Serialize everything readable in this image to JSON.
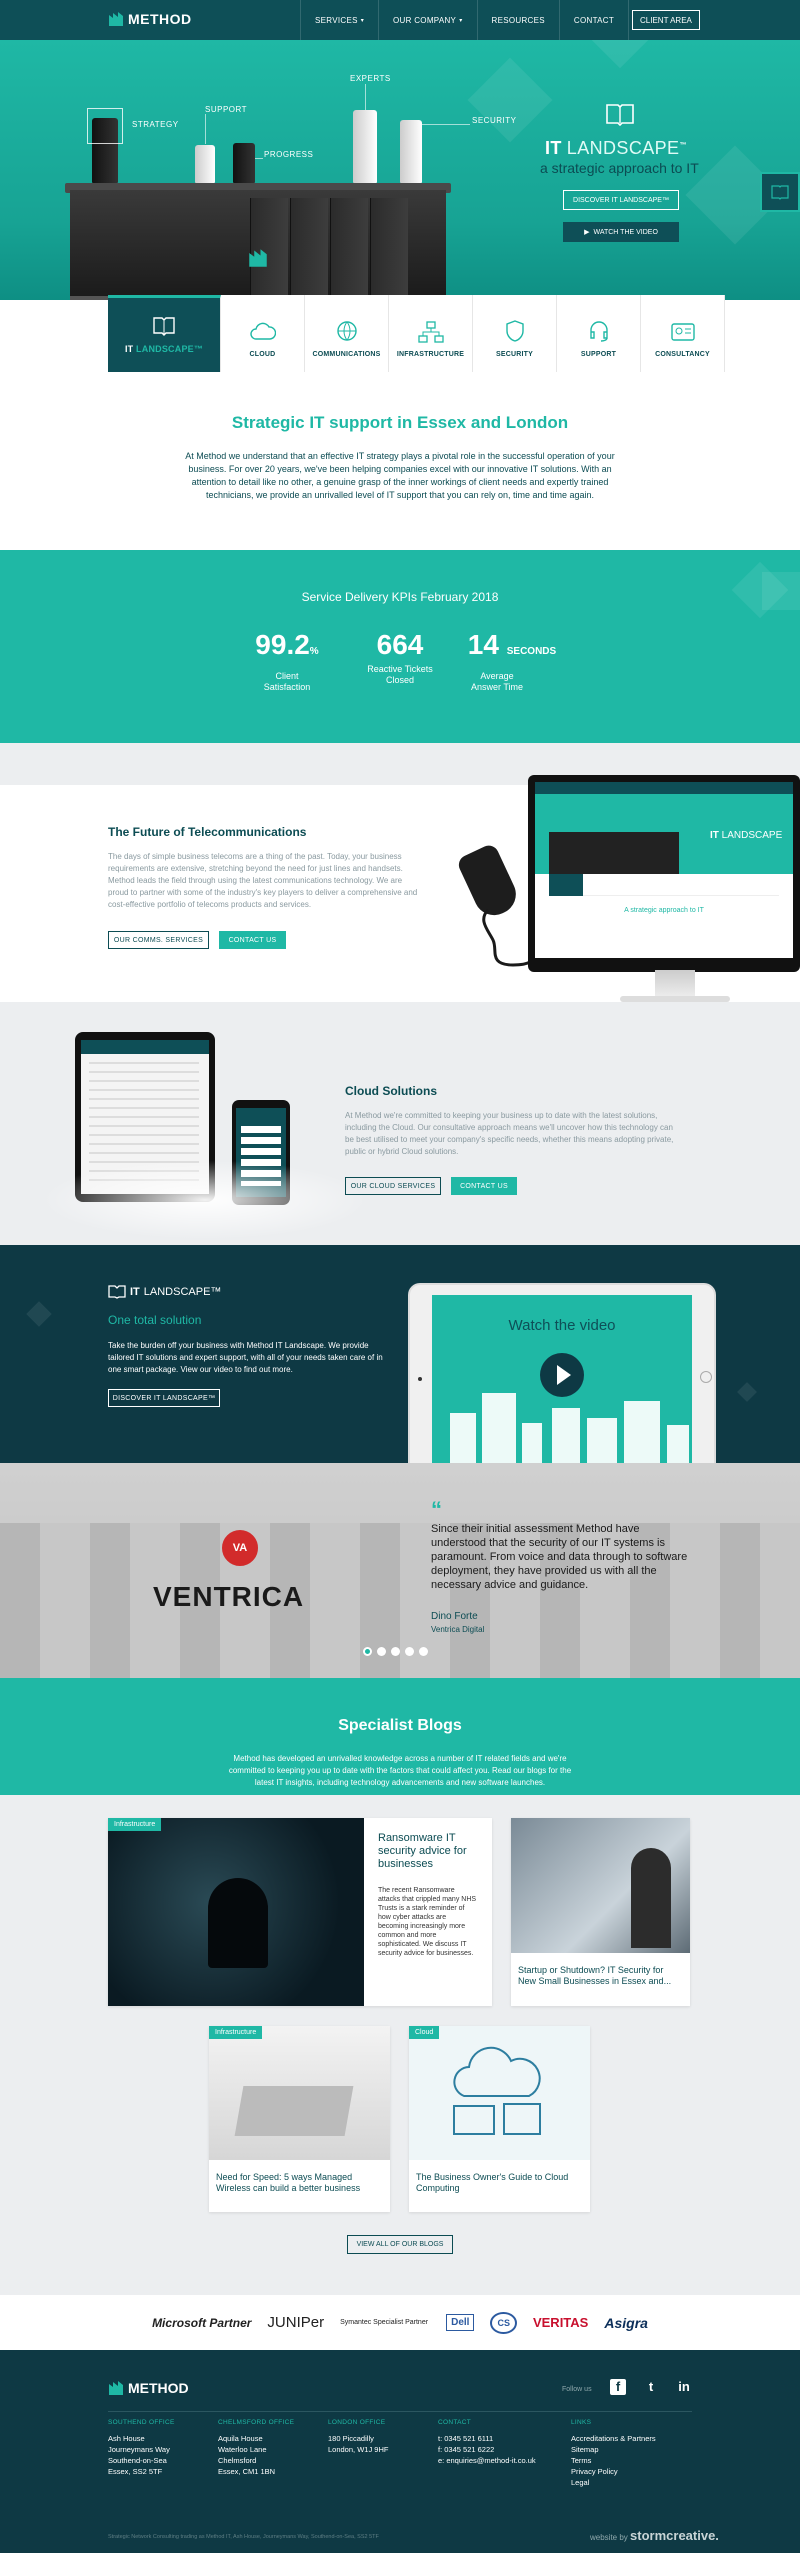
{
  "header": {
    "logo": "METHOD",
    "nav": [
      "SERVICES",
      "OUR COMPANY",
      "RESOURCES",
      "CONTACT"
    ],
    "client_area": "CLIENT AREA"
  },
  "hero": {
    "callouts": [
      "STRATEGY",
      "SUPPORT",
      "PROGRESS",
      "EXPERTS",
      "SECURITY"
    ],
    "title_it": "IT",
    "title_landscape": "LANDSCAPE",
    "tm": "™",
    "subtitle": "a strategic approach to IT",
    "discover_btn": "DISCOVER IT LANDSCAPE™",
    "watch_btn": "WATCH THE VIDEO"
  },
  "tabs": {
    "active_it": "IT",
    "active_landscape": "LANDSCAPE™",
    "items": [
      "CLOUD",
      "COMMUNICATIONS",
      "INFRASTRUCTURE",
      "SECURITY",
      "SUPPORT",
      "CONSULTANCY"
    ]
  },
  "intro": {
    "title": "Strategic IT support in Essex and London",
    "text": "At Method we understand that an effective IT strategy plays a pivotal role in the successful operation of your business. For over 20 years, we've been helping companies excel with our innovative IT solutions. With an attention to detail like no other, a genuine grasp of the inner workings of client needs and expertly trained technicians, we provide an unrivalled level of IT support that you can rely on, time and time again."
  },
  "kpi": {
    "title": "Service Delivery KPIs February 2018",
    "items": [
      {
        "value": "99.2",
        "unit": "%",
        "label": "Client Satisfaction"
      },
      {
        "value": "664",
        "unit": "",
        "label": "Reactive Tickets Closed"
      },
      {
        "value": "14",
        "unit": "SECONDS",
        "label": "Average Answer Time"
      }
    ]
  },
  "telecom": {
    "title": "The Future of Telecommunications",
    "text": "The days of simple business telecoms are a thing of the past. Today, your business requirements are extensive, stretching beyond the need for just lines and handsets. Method leads the field through using the latest communications technology. We are proud to partner with some of the industry's key players to deliver a comprehensive and cost-effective portfolio of telecoms products and services.",
    "btn1": "OUR COMMS. SERVICES",
    "btn2": "CONTACT US",
    "screen_tagline": "A strategic approach to IT"
  },
  "cloud": {
    "title": "Cloud Solutions",
    "text": "At Method we're committed to keeping your business up to date with the latest solutions, including the Cloud. Our consultative approach means we'll uncover how this technology can be best utilised to meet your company's specific needs, whether this means adopting private, public or hybrid Cloud solutions.",
    "btn1": "OUR CLOUD SERVICES",
    "btn2": "CONTACT US"
  },
  "landscape": {
    "logo_it": "IT",
    "logo_landscape": "LANDSCAPE™",
    "subtitle": "One total solution",
    "text": "Take the burden off your business with Method IT Landscape. We provide tailored IT solutions and expert support, with all of your needs taken care of in one smart package. View our video to find out more.",
    "btn": "DISCOVER IT LANDSCAPE™",
    "video_title": "Watch the video"
  },
  "testimonial": {
    "client_mark": "VA",
    "client_name": "VENTRICA",
    "quote": "Since their initial assessment Method have understood that the security of our IT systems is paramount. From voice and data through to software deployment, they have provided us with all the necessary advice and guidance.",
    "author": "Dino Forte",
    "company": "Ventrica Digital",
    "slides": 5,
    "active_slide": 1
  },
  "blogs": {
    "title": "Specialist Blogs",
    "text": "Method has developed an unrivalled knowledge across a number of IT related fields and we're committed to keeping you up to date with the factors that could affect you. Read our blogs for the latest IT insights, including technology advancements and new software launches.",
    "posts": [
      {
        "tag": "Infrastructure",
        "title": "Ransomware IT security advice for businesses",
        "excerpt": "The recent Ransomware attacks that crippled many NHS Trusts is a stark reminder of how cyber attacks are becoming increasingly more common and more sophisticated. We discuss IT security advice for businesses."
      },
      {
        "tag": "",
        "title": "Startup or Shutdown? IT Security for New Small Businesses in Essex and...",
        "excerpt": ""
      },
      {
        "tag": "Infrastructure",
        "title": "Need for Speed: 5 ways Managed Wireless can build a better business",
        "excerpt": ""
      },
      {
        "tag": "Cloud",
        "title": "The Business Owner's Guide to Cloud Computing",
        "excerpt": ""
      }
    ],
    "view_all": "VIEW ALL OF OUR BLOGS"
  },
  "partners": [
    "Microsoft Partner",
    "JUNIPer",
    "Symantec Specialist Partner",
    "Dell",
    "CS",
    "VERITAS",
    "Asigra"
  ],
  "footer": {
    "logo": "METHOD",
    "follow": "Follow us",
    "social": [
      "f",
      "t",
      "in"
    ],
    "columns": [
      {
        "heading": "SOUTHEND OFFICE",
        "lines": [
          "Ash House",
          "Journeymans Way",
          "Southend-on-Sea",
          "Essex, SS2 5TF"
        ]
      },
      {
        "heading": "CHELMSFORD OFFICE",
        "lines": [
          "Aquila House",
          "Waterloo Lane",
          "Chelmsford",
          "Essex, CM1 1BN"
        ]
      },
      {
        "heading": "LONDON OFFICE",
        "lines": [
          "180 Piccadilly",
          "London, W1J 9HF"
        ]
      },
      {
        "heading": "CONTACT",
        "lines": [
          "t: 0345 521 6111",
          "f: 0345 521 6222",
          "e: enquiries@method-it.co.uk"
        ]
      },
      {
        "heading": "LINKS",
        "lines": [
          "Accreditations & Partners",
          "Sitemap",
          "Terms",
          "Privacy Policy",
          "Legal"
        ]
      }
    ],
    "bottom": "Strategic Network Consulting trading as Method IT, Ash House, Journeymans Way, Southend-on-Sea, SS2 5TF",
    "credit_prefix": "website by",
    "credit": "stormcreative."
  }
}
